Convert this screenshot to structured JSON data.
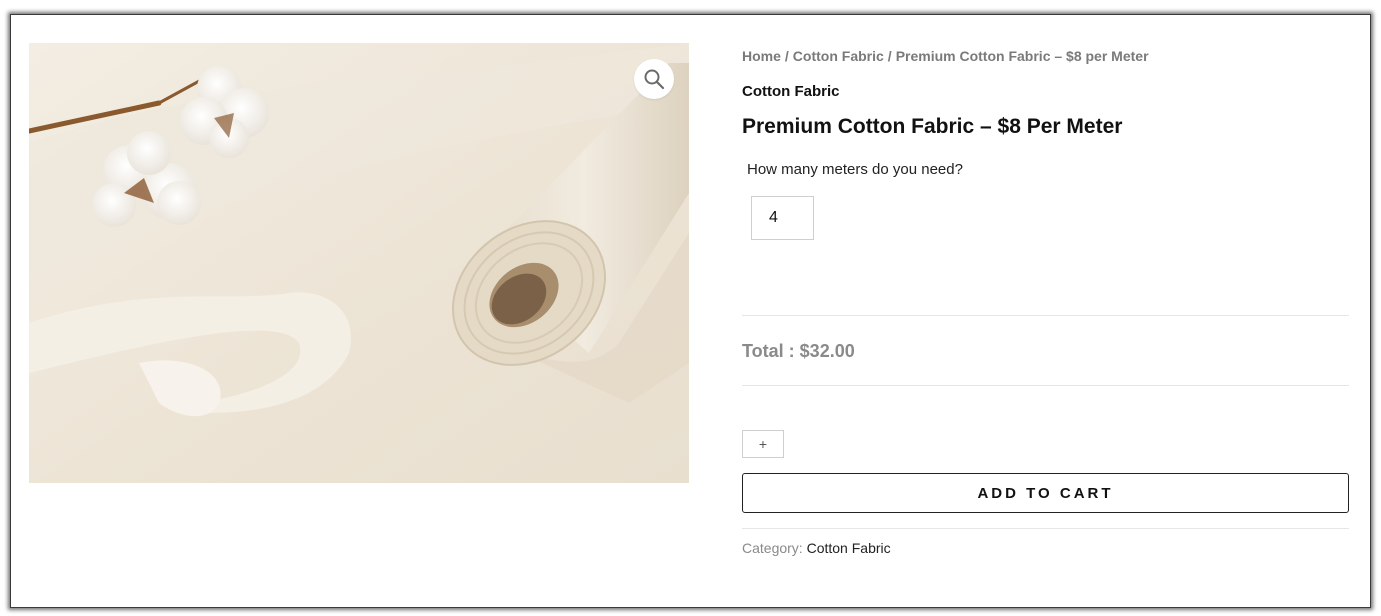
{
  "product": {
    "image_alt": "cotton-fabric-roll",
    "zoom_icon": "magnifier-icon",
    "breadcrumb": {
      "items": [
        "Home",
        "Cotton Fabric",
        "Premium Cotton Fabric – $8 per Meter"
      ],
      "separator": "/"
    },
    "category_heading": "Cotton Fabric",
    "title": "Premium Cotton Fabric – $8 Per Meter",
    "quantity_question": "How many meters do you need?",
    "quantity_value": "4",
    "total_label": "Total :",
    "total_value": "$32.00",
    "plus_label": "+",
    "add_to_cart_label": "ADD TO CART",
    "meta": {
      "category_label": "Category:",
      "category_value": "Cotton Fabric"
    }
  },
  "colors": {
    "frame_border": "#3a3a3a",
    "muted_text": "#7a7a7a",
    "total_text": "#8a8a8a",
    "fabric": "#efe7d9"
  }
}
